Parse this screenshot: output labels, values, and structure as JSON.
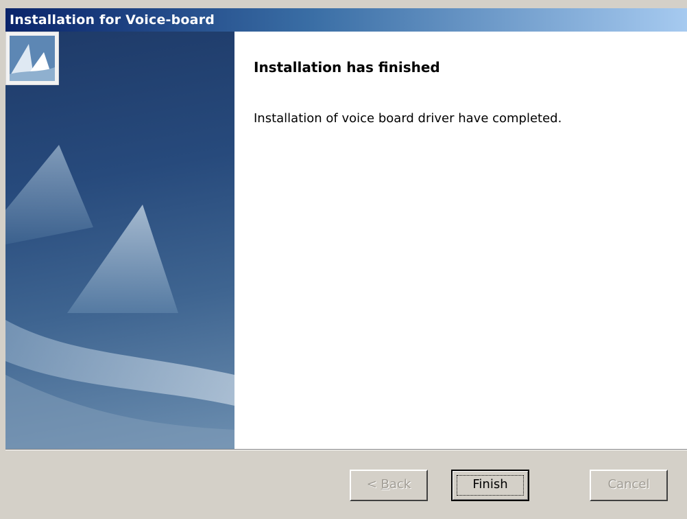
{
  "window": {
    "title": "Installation for Voice-board"
  },
  "content": {
    "heading": "Installation has finished",
    "message": "Installation of voice board driver have completed."
  },
  "buttons": {
    "back_prefix": "< ",
    "back_mnemonic": "B",
    "back_rest": "ack",
    "finish_label": "Finish",
    "cancel_label": "Cancel"
  },
  "colors": {
    "title_bar_start": "#0a246a",
    "title_bar_end": "#a6caf0",
    "dialog_face": "#d4d0c8",
    "banner_dark": "#1e3a68",
    "banner_light": "#6d8fb0"
  },
  "icons": {
    "banner_logo": "installer-logo-icon"
  }
}
